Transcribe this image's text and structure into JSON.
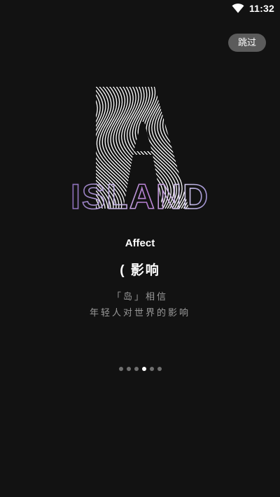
{
  "status_bar": {
    "time": "11:32",
    "wifi_icon": "wifi-icon"
  },
  "skip_button": {
    "label": "跳过"
  },
  "logo": {
    "letter": "A",
    "wordmark": "ISLAND"
  },
  "slide": {
    "title_en": "Affect",
    "title_zh": "( 影响",
    "description": [
      "「岛」相信",
      "年轻人对世界的影响"
    ]
  },
  "pager": {
    "total": 6,
    "active_index": 3
  },
  "colors": {
    "background": "#121212",
    "skip_button_bg": "#5b5b5b",
    "description_text": "#9a9a9a",
    "dot_inactive": "#6f6f6f",
    "dot_active": "#ffffff"
  }
}
